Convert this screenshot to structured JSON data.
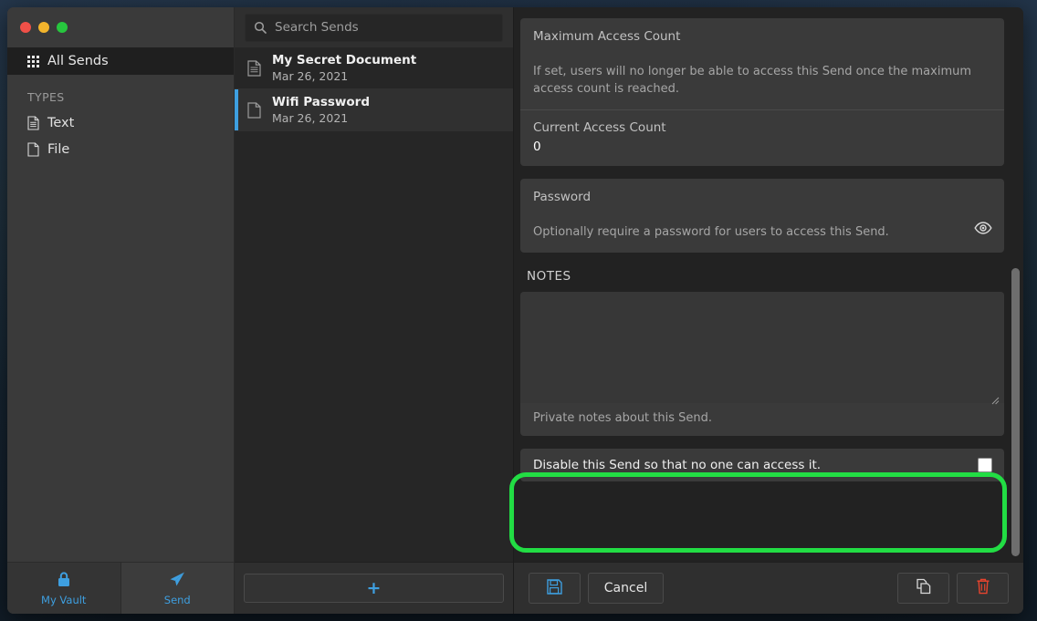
{
  "window": {
    "traffic_lights": [
      "close",
      "minimize",
      "maximize"
    ]
  },
  "sidebar": {
    "all_sends_label": "All Sends",
    "types_header": "TYPES",
    "items": [
      {
        "label": "Text",
        "icon": "text-document-icon"
      },
      {
        "label": "File",
        "icon": "blank-document-icon"
      }
    ],
    "footer_tabs": [
      {
        "label": "My Vault",
        "icon": "lock-icon",
        "active": false
      },
      {
        "label": "Send",
        "icon": "paper-plane-icon",
        "active": true
      }
    ]
  },
  "list": {
    "search_placeholder": "Search Sends",
    "search_value": "",
    "items": [
      {
        "title": "My Secret Document",
        "date": "Mar 26, 2021",
        "icon": "text-document-icon",
        "selected": false
      },
      {
        "title": "Wifi Password",
        "date": "Mar 26, 2021",
        "icon": "blank-document-icon",
        "selected": true
      }
    ],
    "add_button_label": "+"
  },
  "detail": {
    "max_access": {
      "label": "Maximum Access Count",
      "value": "",
      "hint": "If set, users will no longer be able to access this Send once the maximum access count is reached.",
      "current_label": "Current Access Count",
      "current_value": "0"
    },
    "password": {
      "label": "Password",
      "value": "",
      "hint": "Optionally require a password for users to access this Send.",
      "toggle_icon": "eye-icon"
    },
    "notes": {
      "section_title": "NOTES",
      "value": "",
      "hint": "Private notes about this Send."
    },
    "disable": {
      "label": "Disable this Send so that no one can access it.",
      "checked": false
    },
    "toolbar": {
      "save_label": "",
      "save_icon": "save-floppy-icon",
      "cancel_label": "Cancel",
      "copy_icon": "copy-icon",
      "delete_icon": "trash-icon"
    }
  },
  "colors": {
    "accent_blue": "#3e9fe0",
    "highlight_green": "#22dd44",
    "delete_red": "#e8442e",
    "panel_bg": "#222222",
    "card_bg": "#3a3a3a"
  }
}
